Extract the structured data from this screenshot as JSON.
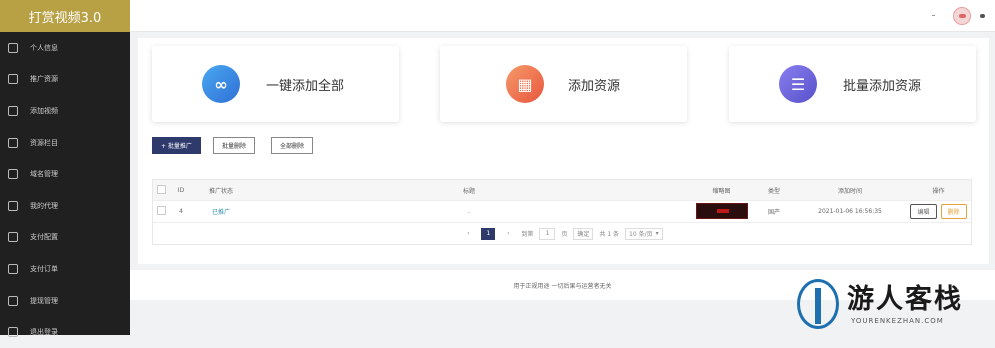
{
  "app": {
    "title": "打赏视频3.0"
  },
  "sidebar": {
    "items": [
      {
        "label": "个人信息",
        "icon": "monitor-icon"
      },
      {
        "label": "推广资源",
        "icon": "layers-icon"
      },
      {
        "label": "添加视频",
        "icon": "cube-icon"
      },
      {
        "label": "资源栏目",
        "icon": "calendar-icon"
      },
      {
        "label": "域名管理",
        "icon": "minus-box-icon"
      },
      {
        "label": "我的代理",
        "icon": "user-icon"
      },
      {
        "label": "支付配置",
        "icon": "lock-icon"
      },
      {
        "label": "支付订单",
        "icon": "order-icon"
      },
      {
        "label": "提现管理",
        "icon": "withdraw-icon"
      },
      {
        "label": "退出登录",
        "icon": "logout-icon"
      }
    ]
  },
  "topbar": {
    "dash": "-"
  },
  "cards": [
    {
      "label": "一键添加全部",
      "icon": "link-icon",
      "color": "#3d8fe0"
    },
    {
      "label": "添加资源",
      "icon": "qrcode-icon",
      "color": "#f07a55"
    },
    {
      "label": "批量添加资源",
      "icon": "list-icon",
      "color": "#6a63d8"
    }
  ],
  "actions": {
    "batch_promote": "+ 批量推广",
    "batch_delete": "批量删除",
    "delete_all": "全部删除"
  },
  "table": {
    "headers": [
      "ID",
      "推广状态",
      "标题",
      "缩略图",
      "类型",
      "添加时间",
      "操作"
    ],
    "rows": [
      {
        "id": "4",
        "status": "已推广",
        "title": ".",
        "type": "国产",
        "time": "2021-01-06 16:56:35",
        "edit": "编辑",
        "delete": "删除"
      }
    ]
  },
  "pagination": {
    "current": "1",
    "to_label": "到第",
    "page_value": "1",
    "page_unit": "页",
    "confirm": "确定",
    "total": "共 1 条",
    "per_page": "10 条/页"
  },
  "footer": {
    "text": "用于正规用途 一切后果与运营者无关"
  },
  "watermark": {
    "text": "游人客栈",
    "sub": "YOURENKEZHAN.COM"
  }
}
